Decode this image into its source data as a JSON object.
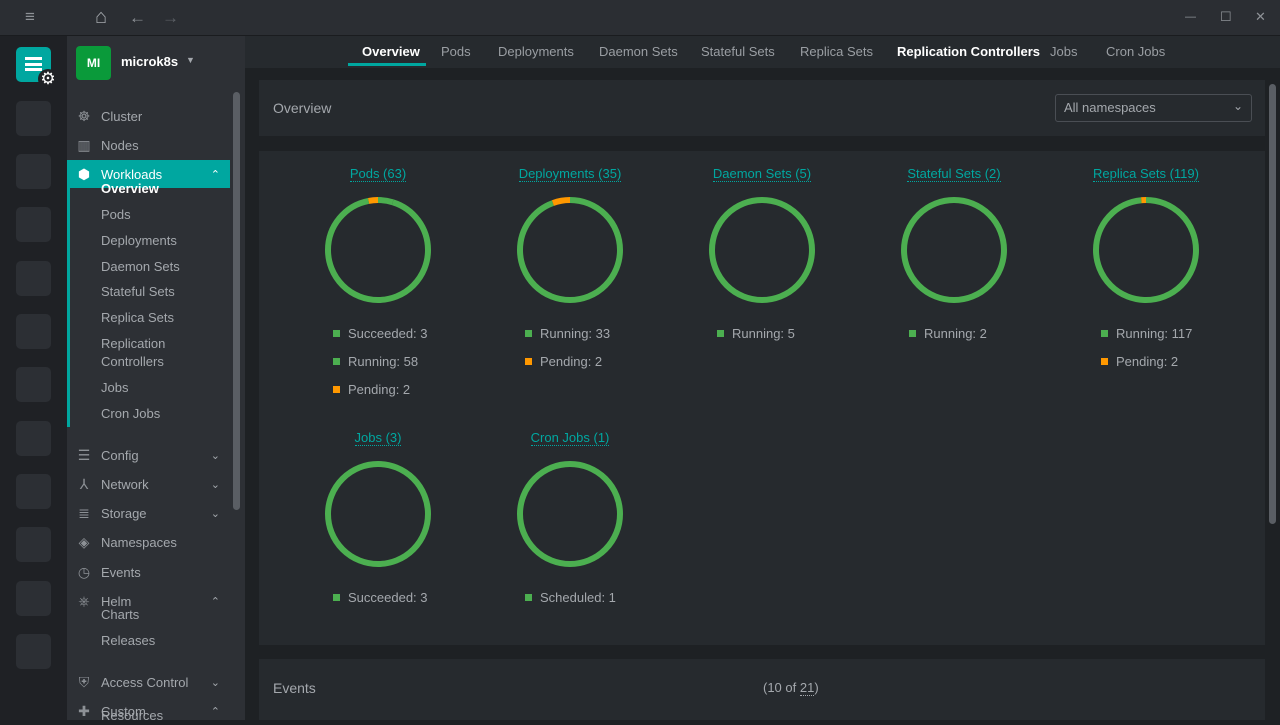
{
  "titlebar": {
    "menu_icon": "≡",
    "home_icon": "⌂",
    "back_icon": "←",
    "forward_icon": "→",
    "minimize": "—",
    "maximize": "☐",
    "close": "✕"
  },
  "cluster": {
    "badge": "MI",
    "name": "microk8s",
    "badge_color": "#0a9a3a"
  },
  "sidebar": {
    "cluster": "Cluster",
    "nodes": "Nodes",
    "workloads": "Workloads",
    "workload_items": [
      "Overview",
      "Pods",
      "Deployments",
      "Daemon Sets",
      "Stateful Sets",
      "Replica Sets",
      "Replication",
      "Controllers",
      "Jobs",
      "Cron Jobs"
    ],
    "config": "Config",
    "network": "Network",
    "storage": "Storage",
    "namespaces": "Namespaces",
    "events": "Events",
    "helm": "Helm",
    "charts": "Charts",
    "releases": "Releases",
    "access_control": "Access Control",
    "custom": "Custom",
    "resources": "Resources"
  },
  "tabs": [
    "Overview",
    "Pods",
    "Deployments",
    "Daemon Sets",
    "Stateful Sets",
    "Replica Sets",
    "Replication Controllers",
    "Jobs",
    "Cron Jobs"
  ],
  "overview": {
    "title": "Overview",
    "namespace_select": "All namespaces"
  },
  "colors": {
    "accent": "#00a7a0",
    "running": "#4caf50",
    "pending": "#ff9800"
  },
  "chart_data": {
    "type": "pie",
    "charts": [
      {
        "title": "Pods (63)",
        "segments": [
          {
            "label": "Succeeded: 3",
            "value": 3,
            "status": "running"
          },
          {
            "label": "Running: 58",
            "value": 58,
            "status": "running"
          },
          {
            "label": "Pending: 2",
            "value": 2,
            "status": "pending"
          }
        ]
      },
      {
        "title": "Deployments (35)",
        "segments": [
          {
            "label": "Running: 33",
            "value": 33,
            "status": "running"
          },
          {
            "label": "Pending: 2",
            "value": 2,
            "status": "pending"
          }
        ]
      },
      {
        "title": "Daemon Sets (5)",
        "segments": [
          {
            "label": "Running: 5",
            "value": 5,
            "status": "running"
          }
        ]
      },
      {
        "title": "Stateful Sets (2)",
        "segments": [
          {
            "label": "Running: 2",
            "value": 2,
            "status": "running"
          }
        ]
      },
      {
        "title": "Replica Sets (119)",
        "segments": [
          {
            "label": "Running: 117",
            "value": 117,
            "status": "running"
          },
          {
            "label": "Pending: 2",
            "value": 2,
            "status": "pending"
          }
        ]
      },
      {
        "title": "Jobs (3)",
        "segments": [
          {
            "label": "Succeeded: 3",
            "value": 3,
            "status": "running"
          }
        ]
      },
      {
        "title": "Cron Jobs (1)",
        "segments": [
          {
            "label": "Scheduled: 1",
            "value": 1,
            "status": "running"
          }
        ]
      }
    ]
  },
  "events": {
    "title": "Events",
    "count_prefix": "(10 of ",
    "count_total": "21",
    "count_suffix": ")"
  }
}
